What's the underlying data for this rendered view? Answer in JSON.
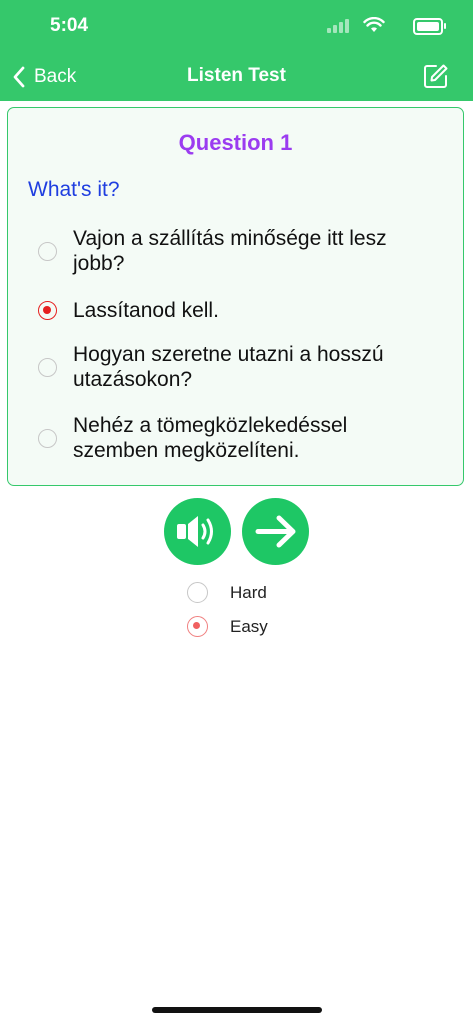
{
  "status_bar": {
    "time": "5:04"
  },
  "nav": {
    "back_label": "Back",
    "title": "Listen Test"
  },
  "question": {
    "title": "Question 1",
    "prompt": "What's it?",
    "options": [
      {
        "text": "Vajon a szállítás minősége itt lesz jobb?",
        "selected": false
      },
      {
        "text": "Lassítanod kell.",
        "selected": true
      },
      {
        "text": "Hogyan szeretne utazni a hosszú utazásokon?",
        "selected": false
      },
      {
        "text": "Nehéz a tömegközlekedéssel szemben megközelíteni.",
        "selected": false
      }
    ]
  },
  "difficulty": {
    "options": [
      {
        "label": "Hard",
        "selected": false
      },
      {
        "label": "Easy",
        "selected": true
      }
    ]
  },
  "colors": {
    "accent": "#35c86b",
    "button": "#1ec765",
    "question_title": "#9b3cf0",
    "prompt": "#1f3ee0",
    "selected": "#e62020"
  }
}
